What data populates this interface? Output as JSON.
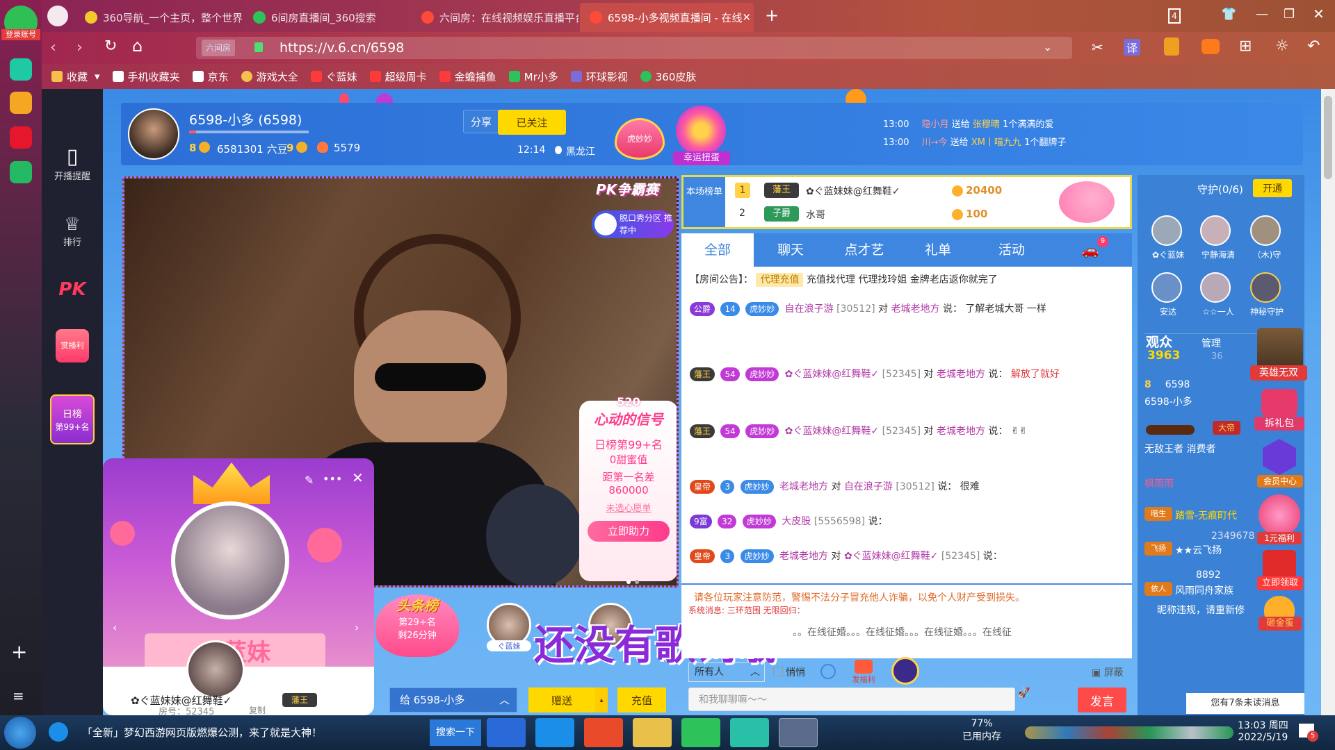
{
  "browser": {
    "login_label": "登录账号",
    "tabs": [
      {
        "title": "360导航_一个主页，整个世界"
      },
      {
        "title": "6间房直播间_360搜索"
      },
      {
        "title": "六间房：在线视频娱乐直播平台"
      },
      {
        "title": "6598-小多视频直播间 - 在线"
      }
    ],
    "tab_count": "4",
    "url": "https://v.6.cn/6598",
    "url_site_tag": "六间房",
    "translate_label": "译",
    "bookmarks": [
      "收藏",
      "手机收藏夹",
      "京东",
      "游戏大全",
      "ぐ蓝妹",
      "超级周卡",
      "金蟾捕鱼",
      "Mr小多",
      "环球影视",
      "360皮肤"
    ]
  },
  "sidenav": {
    "items": [
      {
        "label": "开播提醒"
      },
      {
        "label": "排行"
      }
    ],
    "pk_label": "PK",
    "gift_label": "赏播利",
    "daily_rank": {
      "title": "日榜",
      "value": "第99+名"
    }
  },
  "host": {
    "name": "6598-小多 (6598)",
    "level_left": "8",
    "beans": "6581301 六豆",
    "level_right": "9",
    "fans": "5579",
    "time": "12:14",
    "location": "黑龙江",
    "share_label": "分享",
    "follow_label": "已关注"
  },
  "header_extras": {
    "heart_badge": "虎妙妙",
    "lucky_egg": "幸运扭蛋",
    "feed": [
      {
        "time": "13:00",
        "sender": "隐小月",
        "verb": "送给",
        "receiver": "张穆晴",
        "gift": "1个满满的爱"
      },
      {
        "time": "13:00",
        "sender": "川→今",
        "verb": "送给",
        "receiver": "XM丨喵九九",
        "gift": "1个翻牌子"
      }
    ]
  },
  "video": {
    "pk_title": "PK争霸赛",
    "promo": "脱口秀分区 推荐中",
    "signal": {
      "num": "520",
      "title": "心动的信号",
      "rank": "日榜第99+名",
      "sweet": "0甜蜜值",
      "gap_label": "距第一名差",
      "gap_value": "860000",
      "wish": "未选心愿单",
      "help_btn": "立即助力"
    },
    "headline": {
      "title": "头条榜",
      "rank": "第29+名",
      "time": "剩26分钟"
    },
    "lyrics": "还没有歌词哦",
    "fans_name": "ぐ蓝妹"
  },
  "popcard": {
    "name_big": "ぐ蓝妹",
    "nickname": "✿ぐ蓝妹妹@红舞鞋✓",
    "room_label": "房号：52345",
    "copy_label": "复制",
    "badge": "藩王"
  },
  "gift_bar": {
    "recipient": "给 6598-小多",
    "send_label": "赠送",
    "recharge_label": "充值"
  },
  "rank": {
    "title": "本场榜单",
    "rows": [
      {
        "num": "1",
        "title": "藩王",
        "name": "✿ぐ蓝妹妹@红舞鞋✓",
        "score": "20400"
      },
      {
        "num": "2",
        "title": "子爵",
        "name": "水哥",
        "score": "100"
      }
    ]
  },
  "chat_tabs": [
    "全部",
    "聊天",
    "点才艺",
    "礼单",
    "活动"
  ],
  "car_badge": "9",
  "chat": {
    "notice_label": "【房间公告】：",
    "notice_tag": "代理充值",
    "notice_text": "充值找代理 代理找玲姐 金牌老店返你就完了",
    "messages": [
      {
        "title": "公爵",
        "level": "14",
        "fan": "虎妙妙",
        "name": "自在浪子游",
        "id": "[30512]",
        "to": "老城老地方",
        "text": "了解老城大哥 一样"
      },
      {
        "title": "藩王",
        "level": "54",
        "fan": "虎妙妙",
        "name": "✿ぐ蓝妹妹@红舞鞋✓",
        "id": "[52345]",
        "to": "老城老地方",
        "text": "解放了就好"
      },
      {
        "title": "藩王",
        "level": "54",
        "fan": "虎妙妙",
        "name": "✿ぐ蓝妹妹@红舞鞋✓",
        "id": "[52345]",
        "to": "老城老地方",
        "text": "✌✌"
      },
      {
        "title": "皇帝",
        "level": "3",
        "fan": "虎妙妙",
        "name": "老城老地方",
        "to": "自在浪子游",
        "id": "[30512]",
        "text": "很难"
      },
      {
        "title": "9富",
        "level": "32",
        "fan": "虎妙妙",
        "name": "大皮股",
        "id": "[5556598]",
        "text": ""
      },
      {
        "title": "皇帝",
        "level": "3",
        "fan": "虎妙妙",
        "name": "老城老地方",
        "to": "✿ぐ蓝妹妹@红舞鞋✓",
        "id": "[52345]",
        "text": ""
      }
    ],
    "say": "说：",
    "to_label": "对",
    "warning": "请各位玩家注意防范，警惕不法分子冒充他人诈骗，以免个人财产受到损失。",
    "sys": "系统消息: 三环范围 无限回归：",
    "marquee": "。。在线征婚。。。在线征婚。。。在线征婚。。。在线征",
    "scope": "所有人",
    "whisper": "悄悄",
    "fuli": "发福利",
    "block": "屏蔽",
    "input_placeholder": "和我聊聊嘛～～",
    "send_label": "发言"
  },
  "right": {
    "guard_title": "守护(0/6)",
    "open_label": "开通",
    "guards": [
      "✿ぐ蓝妹",
      "宁静海清",
      "（木)守",
      "安达",
      "☆☆一人",
      "神秘守护"
    ],
    "audience_label": "观众",
    "audience_count": "3963",
    "manage_label": "管理",
    "manage_count": "36",
    "viewers": [
      {
        "level": "8",
        "name": "6598"
      },
      {
        "name": "6598-小多"
      },
      {
        "name": "无敌王者 消费者",
        "tag": "大帝"
      },
      {
        "name": "枫雨雨"
      },
      {
        "name": "踏雪-无痕町代",
        "tag": "暗生"
      },
      {
        "name": "2349678"
      },
      {
        "name": "★★云飞扬",
        "tag": "飞扬"
      },
      {
        "name": "8892"
      },
      {
        "name": "风雨同舟家族",
        "tag": "依人"
      },
      {
        "name": "昵称违规，请重新修"
      }
    ],
    "promos": [
      "英雄无双",
      "拆礼包",
      "会员中心",
      "1元福利",
      "立即领取",
      "砸金蛋"
    ],
    "unread": "您有7条未读消息"
  },
  "taskbar": {
    "news": "「全新」梦幻西游网页版燃爆公测，来了就是大神！",
    "search": "搜索一下",
    "mem_pct": "77%",
    "mem_label": "已用内存",
    "clock_time": "13:03 周四",
    "clock_date": "2022/5/19",
    "notif": "5"
  },
  "colors": {
    "accent": "#3e86df",
    "follow": "#ffd800",
    "send": "#ff4a4a",
    "nick": "#b03aa6"
  }
}
